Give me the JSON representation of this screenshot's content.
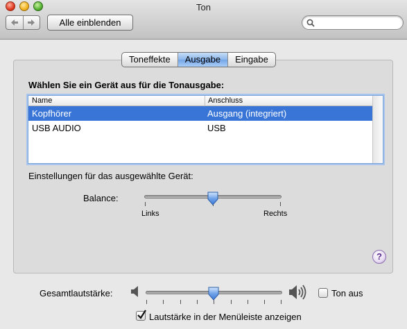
{
  "window": {
    "title": "Ton"
  },
  "toolbar": {
    "back_icon": "back-arrow-icon",
    "forward_icon": "forward-arrow-icon",
    "show_all_label": "Alle einblenden",
    "search_placeholder": "",
    "search_value": ""
  },
  "tabs": [
    {
      "label": "Toneffekte",
      "active": false
    },
    {
      "label": "Ausgabe",
      "active": true
    },
    {
      "label": "Eingabe",
      "active": false
    }
  ],
  "output": {
    "prompt": "Wählen Sie ein Gerät aus für die Tonausgabe:",
    "columns": {
      "name": "Name",
      "connection": "Anschluss"
    },
    "devices": [
      {
        "name": "Kopfhörer",
        "connection": "Ausgang (integriert)",
        "selected": true
      },
      {
        "name": "USB  AUDIO",
        "connection": "USB",
        "selected": false
      }
    ],
    "settings_label": "Einstellungen für das ausgewählte Gerät:",
    "balance": {
      "label": "Balance:",
      "left_caption": "Links",
      "right_caption": "Rechts",
      "value": 0.5
    },
    "help_label": "?"
  },
  "volume": {
    "label": "Gesamtlautstärke:",
    "value": 0.5,
    "low_icon": "speaker-low-icon",
    "high_icon": "speaker-high-icon",
    "mute_label": "Ton aus",
    "mute_checked": false
  },
  "menubar_checkbox": {
    "label": "Lautstärke in der Menüleiste anzeigen",
    "checked": true
  },
  "colors": {
    "selection": "#3875d7",
    "tab_active": "#8cb6ea",
    "focus_ring": "#a6c4ec"
  }
}
